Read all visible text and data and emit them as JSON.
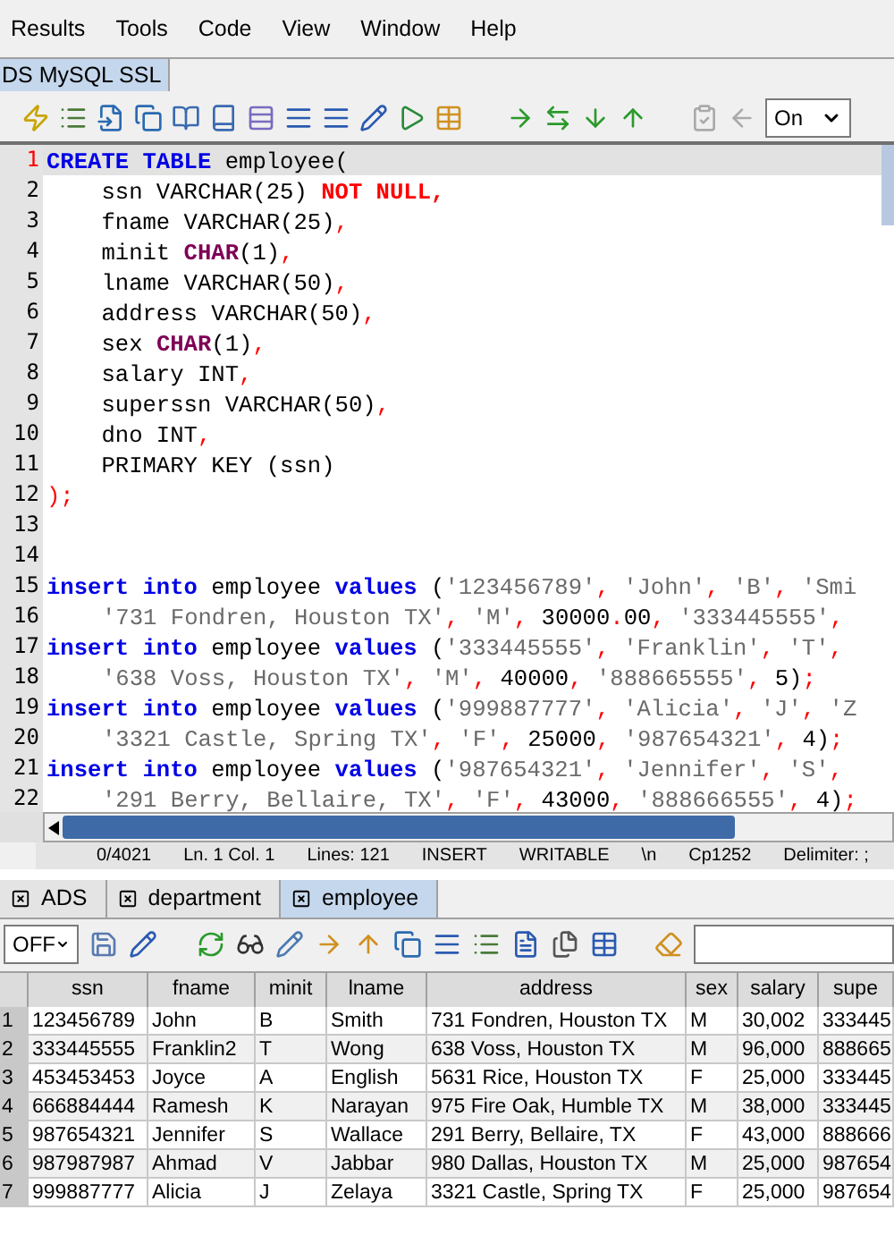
{
  "menu": [
    {
      "label": "Results"
    },
    {
      "label": "Tools"
    },
    {
      "label": "Code"
    },
    {
      "label": "View"
    },
    {
      "label": "Window"
    },
    {
      "label": "Help"
    }
  ],
  "connection_tabs": [
    {
      "label": "DS MySQL SSL",
      "selected": true
    }
  ],
  "toolbar": {
    "dropdown": "On"
  },
  "editor": {
    "lines": [
      {
        "number": "1",
        "current": true,
        "tokens": [
          {
            "kind": "kw",
            "text": "CREATE TABLE"
          },
          {
            "kind": "t",
            "text": " employee("
          }
        ]
      },
      {
        "number": "2",
        "current": false,
        "tokens": [
          {
            "kind": "t",
            "text": "    ssn VARCHAR(25) "
          },
          {
            "kind": "err",
            "text": "NOT NULL,"
          }
        ]
      },
      {
        "number": "3",
        "current": false,
        "tokens": [
          {
            "kind": "t",
            "text": "    fname VARCHAR(25)"
          },
          {
            "kind": "p",
            "text": ","
          }
        ]
      },
      {
        "number": "4",
        "current": false,
        "tokens": [
          {
            "kind": "t",
            "text": "    minit "
          },
          {
            "kind": "type",
            "text": "CHAR"
          },
          {
            "kind": "t",
            "text": "(1)"
          },
          {
            "kind": "p",
            "text": ","
          }
        ]
      },
      {
        "number": "5",
        "current": false,
        "tokens": [
          {
            "kind": "t",
            "text": "    lname VARCHAR(50)"
          },
          {
            "kind": "p",
            "text": ","
          }
        ]
      },
      {
        "number": "6",
        "current": false,
        "tokens": [
          {
            "kind": "t",
            "text": "    address VARCHAR(50)"
          },
          {
            "kind": "p",
            "text": ","
          }
        ]
      },
      {
        "number": "7",
        "current": false,
        "tokens": [
          {
            "kind": "t",
            "text": "    sex "
          },
          {
            "kind": "type",
            "text": "CHAR"
          },
          {
            "kind": "t",
            "text": "(1)"
          },
          {
            "kind": "p",
            "text": ","
          }
        ]
      },
      {
        "number": "8",
        "current": false,
        "tokens": [
          {
            "kind": "t",
            "text": "    salary INT"
          },
          {
            "kind": "p",
            "text": ","
          }
        ]
      },
      {
        "number": "9",
        "current": false,
        "tokens": [
          {
            "kind": "t",
            "text": "    superssn VARCHAR(50)"
          },
          {
            "kind": "p",
            "text": ","
          }
        ]
      },
      {
        "number": "10",
        "current": false,
        "tokens": [
          {
            "kind": "t",
            "text": "    dno INT"
          },
          {
            "kind": "p",
            "text": ","
          }
        ]
      },
      {
        "number": "11",
        "current": false,
        "tokens": [
          {
            "kind": "t",
            "text": "    PRIMARY KEY (ssn)"
          }
        ]
      },
      {
        "number": "12",
        "current": false,
        "tokens": [
          {
            "kind": "p",
            "text": ");"
          }
        ]
      },
      {
        "number": "13",
        "current": false
      },
      {
        "number": "14",
        "current": false
      },
      {
        "number": "15",
        "current": false,
        "tokens": [
          {
            "kind": "kw",
            "text": "insert into"
          },
          {
            "kind": "t",
            "text": " employee "
          },
          {
            "kind": "kw",
            "text": "values"
          },
          {
            "kind": "t",
            "text": " ("
          },
          {
            "kind": "s",
            "text": "'123456789'"
          },
          {
            "kind": "p",
            "text": ", "
          },
          {
            "kind": "s",
            "text": "'John'"
          },
          {
            "kind": "p",
            "text": ", "
          },
          {
            "kind": "s",
            "text": "'B'"
          },
          {
            "kind": "p",
            "text": ", "
          },
          {
            "kind": "s",
            "text": "'Smi"
          }
        ]
      },
      {
        "number": "16",
        "current": false,
        "continuation": true,
        "tokens": [
          {
            "kind": "s",
            "text": "'731 Fondren, Houston TX'"
          },
          {
            "kind": "p",
            "text": ", "
          },
          {
            "kind": "s",
            "text": "'M'"
          },
          {
            "kind": "p",
            "text": ", "
          },
          {
            "kind": "t",
            "text": "30000"
          },
          {
            "kind": "p",
            "text": "."
          },
          {
            "kind": "t",
            "text": "00"
          },
          {
            "kind": "p",
            "text": ", "
          },
          {
            "kind": "s",
            "text": "'333445555'"
          },
          {
            "kind": "p",
            "text": ","
          }
        ]
      },
      {
        "number": "17",
        "current": false,
        "tokens": [
          {
            "kind": "kw",
            "text": "insert into"
          },
          {
            "kind": "t",
            "text": " employee "
          },
          {
            "kind": "kw",
            "text": "values"
          },
          {
            "kind": "t",
            "text": " ("
          },
          {
            "kind": "s",
            "text": "'333445555'"
          },
          {
            "kind": "p",
            "text": ", "
          },
          {
            "kind": "s",
            "text": "'Franklin'"
          },
          {
            "kind": "p",
            "text": ", "
          },
          {
            "kind": "s",
            "text": "'T'"
          },
          {
            "kind": "p",
            "text": ","
          }
        ]
      },
      {
        "number": "18",
        "current": false,
        "continuation": true,
        "tokens": [
          {
            "kind": "s",
            "text": "'638 Voss, Houston TX'"
          },
          {
            "kind": "p",
            "text": ", "
          },
          {
            "kind": "s",
            "text": "'M'"
          },
          {
            "kind": "p",
            "text": ", "
          },
          {
            "kind": "t",
            "text": "40000"
          },
          {
            "kind": "p",
            "text": ", "
          },
          {
            "kind": "s",
            "text": "'888665555'"
          },
          {
            "kind": "p",
            "text": ", "
          },
          {
            "kind": "t",
            "text": "5)"
          },
          {
            "kind": "p",
            "text": ";"
          }
        ]
      },
      {
        "number": "19",
        "current": false,
        "tokens": [
          {
            "kind": "kw",
            "text": "insert into"
          },
          {
            "kind": "t",
            "text": " employee "
          },
          {
            "kind": "kw",
            "text": "values"
          },
          {
            "kind": "t",
            "text": " ("
          },
          {
            "kind": "s",
            "text": "'999887777'"
          },
          {
            "kind": "p",
            "text": ", "
          },
          {
            "kind": "s",
            "text": "'Alicia'"
          },
          {
            "kind": "p",
            "text": ", "
          },
          {
            "kind": "s",
            "text": "'J'"
          },
          {
            "kind": "p",
            "text": ", "
          },
          {
            "kind": "s",
            "text": "'Z"
          }
        ]
      },
      {
        "number": "20",
        "current": false,
        "continuation": true,
        "tokens": [
          {
            "kind": "s",
            "text": "'3321 Castle, Spring TX'"
          },
          {
            "kind": "p",
            "text": ", "
          },
          {
            "kind": "s",
            "text": "'F'"
          },
          {
            "kind": "p",
            "text": ", "
          },
          {
            "kind": "t",
            "text": "25000"
          },
          {
            "kind": "p",
            "text": ", "
          },
          {
            "kind": "s",
            "text": "'987654321'"
          },
          {
            "kind": "p",
            "text": ", "
          },
          {
            "kind": "t",
            "text": "4)"
          },
          {
            "kind": "p",
            "text": ";"
          }
        ]
      },
      {
        "number": "21",
        "current": false,
        "tokens": [
          {
            "kind": "kw",
            "text": "insert into"
          },
          {
            "kind": "t",
            "text": " employee "
          },
          {
            "kind": "kw",
            "text": "values"
          },
          {
            "kind": "t",
            "text": " ("
          },
          {
            "kind": "s",
            "text": "'987654321'"
          },
          {
            "kind": "p",
            "text": ", "
          },
          {
            "kind": "s",
            "text": "'Jennifer'"
          },
          {
            "kind": "p",
            "text": ", "
          },
          {
            "kind": "s",
            "text": "'S'"
          },
          {
            "kind": "p",
            "text": ","
          }
        ]
      },
      {
        "number": "22",
        "current": false,
        "continuation": true,
        "tokens": [
          {
            "kind": "s",
            "text": "'291 Berry, Bellaire, TX'"
          },
          {
            "kind": "p",
            "text": ", "
          },
          {
            "kind": "s",
            "text": "'F'"
          },
          {
            "kind": "p",
            "text": ", "
          },
          {
            "kind": "t",
            "text": "43000"
          },
          {
            "kind": "p",
            "text": ", "
          },
          {
            "kind": "s",
            "text": "'888666555'"
          },
          {
            "kind": "p",
            "text": ", "
          },
          {
            "kind": "t",
            "text": "4)"
          },
          {
            "kind": "p",
            "text": ";"
          }
        ]
      }
    ]
  },
  "status_bar": [
    "0/4021",
    "Ln. 1 Col. 1",
    "Lines: 121",
    "INSERT",
    "WRITABLE",
    "\\n",
    "Cp1252",
    "Delimiter: ;"
  ],
  "result_tabs": [
    {
      "label": "ADS",
      "selected": false
    },
    {
      "label": "department",
      "selected": false
    },
    {
      "label": "employee",
      "selected": true
    }
  ],
  "result_toolbar": {
    "dropdown": "OFF"
  },
  "table": {
    "columns": [
      "ssn",
      "fname",
      "minit",
      "lname",
      "address",
      "sex",
      "salary",
      "supe"
    ],
    "rows": [
      {
        "number": "1",
        "cells": [
          "123456789",
          "John",
          "B",
          "Smith",
          "731 Fondren, Houston TX",
          "M",
          "30,002",
          "333445"
        ]
      },
      {
        "number": "2",
        "cells": [
          "333445555",
          "Franklin2",
          "T",
          "Wong",
          "638 Voss, Houston TX",
          "M",
          "96,000",
          "888665"
        ]
      },
      {
        "number": "3",
        "cells": [
          "453453453",
          "Joyce",
          "A",
          "English",
          "5631 Rice, Houston TX",
          "F",
          "25,000",
          "333445"
        ]
      },
      {
        "number": "4",
        "cells": [
          "666884444",
          "Ramesh",
          "K",
          "Narayan",
          "975 Fire Oak, Humble TX",
          "M",
          "38,000",
          "333445"
        ]
      },
      {
        "number": "5",
        "cells": [
          "987654321",
          "Jennifer",
          "S",
          "Wallace",
          "291 Berry, Bellaire, TX",
          "F",
          "43,000",
          "888666"
        ]
      },
      {
        "number": "6",
        "cells": [
          "987987987",
          "Ahmad",
          "V",
          "Jabbar",
          "980 Dallas, Houston TX",
          "M",
          "25,000",
          "987654"
        ]
      },
      {
        "number": "7",
        "cells": [
          "999887777",
          "Alicia",
          "J",
          "Zelaya",
          "3321 Castle, Spring TX",
          "F",
          "25,000",
          "987654"
        ]
      }
    ]
  }
}
